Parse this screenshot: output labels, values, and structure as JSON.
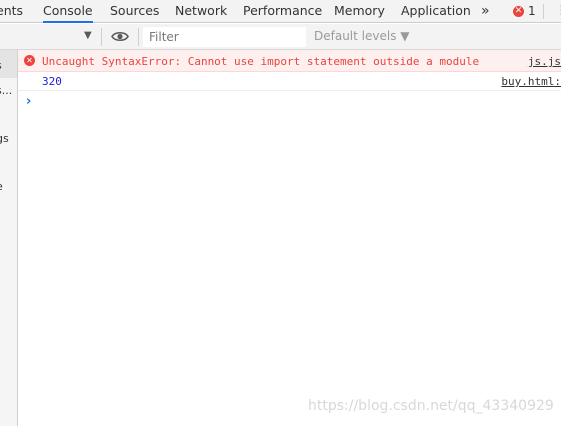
{
  "tabs": [
    {
      "label": "ents",
      "active": false
    },
    {
      "label": "Console",
      "active": true
    },
    {
      "label": "Sources",
      "active": false
    },
    {
      "label": "Network",
      "active": false
    },
    {
      "label": "Performance",
      "active": false
    },
    {
      "label": "Memory",
      "active": false
    },
    {
      "label": "Application",
      "active": false
    }
  ],
  "more_tabs_glyph": "»",
  "error_count": "1",
  "toolbar": {
    "filter_placeholder": "Filter",
    "levels_label": "Default levels ▼"
  },
  "sidebar": {
    "items": [
      "s",
      "s...",
      "gs",
      "e"
    ]
  },
  "console": {
    "messages": [
      {
        "level": "error",
        "text": "Uncaught SyntaxError: Cannot use import statement outside a module",
        "source": "js.js"
      },
      {
        "level": "log",
        "text": "320",
        "source": "buy.html:"
      }
    ],
    "prompt_glyph": "›"
  },
  "colors": {
    "accent": "#1a73e8",
    "error": "#e8453c",
    "error_bg": "#fff0f0"
  },
  "watermark": "https://blog.csdn.net/qq_43340929"
}
